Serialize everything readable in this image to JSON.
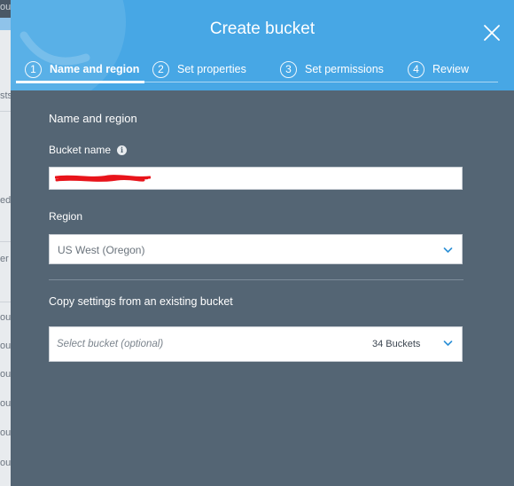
{
  "background_fragments": [
    "ou",
    "sts",
    "ed",
    "er",
    "ou",
    "ou",
    "ou",
    "ou",
    "ou",
    "ou"
  ],
  "modal": {
    "title": "Create bucket",
    "close_icon": "close-icon",
    "colors": {
      "header": "#47a7e5",
      "body": "#546574",
      "accent": "#2b8fd6"
    }
  },
  "steps": [
    {
      "number": "1",
      "label": "Name and region",
      "active": true
    },
    {
      "number": "2",
      "label": "Set properties",
      "active": false
    },
    {
      "number": "3",
      "label": "Set permissions",
      "active": false
    },
    {
      "number": "4",
      "label": "Review",
      "active": false
    }
  ],
  "form": {
    "section_title": "Name and region",
    "bucket_name_label": "Bucket name",
    "bucket_name_value": "",
    "info_icon": "info-icon",
    "region_label": "Region",
    "region_value": "US West (Oregon)",
    "copy_section_title": "Copy settings from an existing bucket",
    "copy_placeholder": "Select bucket (optional)",
    "bucket_count": "34 Buckets"
  }
}
